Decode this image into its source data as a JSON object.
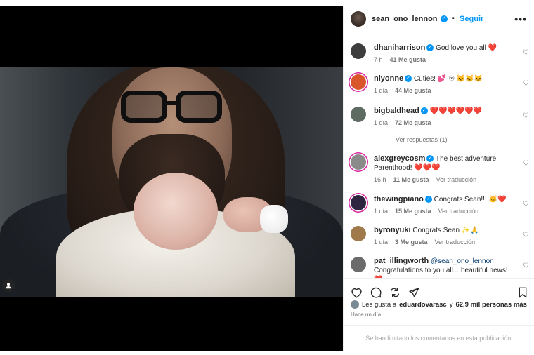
{
  "post": {
    "author": "sean_ono_lennon",
    "follow_label": "Seguir",
    "more_label": "•••",
    "separator": "•"
  },
  "comments": [
    {
      "user": "dhaniharrison",
      "verified": true,
      "text": "God love you all",
      "emoji": "❤️",
      "time": "7 h",
      "likes": "41 Me gusta",
      "extra": "···",
      "avatar_color": "#3d3d3d"
    },
    {
      "user": "nlyonne",
      "verified": true,
      "text": "Cuties!",
      "emoji": "💕 ♾ 🐱🐱🐱",
      "time": "1 día",
      "likes": "44 Me gusta",
      "avatar_color": "#d9552b"
    },
    {
      "user": "bigbaldhead",
      "verified": true,
      "text": "",
      "emoji": "❤️❤️❤️❤️❤️❤️",
      "time": "1 día",
      "likes": "72 Me gusta",
      "avatar_color": "#5e6b62"
    },
    {
      "user": "alexgreycosm",
      "verified": true,
      "text": "The best adventure! Parenthood!",
      "emoji": "❤️❤️❤️",
      "time": "16 h",
      "likes": "11 Me gusta",
      "translate": "Ver traducción",
      "avatar_color": "#8a8a8a"
    },
    {
      "user": "thewingpiano",
      "verified": true,
      "text": "Congrats Sean!!!",
      "emoji": "🐱❤️",
      "time": "1 día",
      "likes": "15 Me gusta",
      "translate": "Ver traducción",
      "avatar_color": "#2e2540"
    },
    {
      "user": "byronyuki",
      "verified": false,
      "text": "Congrats Sean",
      "emoji": "✨🙏",
      "time": "1 día",
      "likes": "3 Me gusta",
      "translate": "Ver traducción",
      "avatar_color": "#a07a4a"
    },
    {
      "user": "pat_illingworth",
      "verified": false,
      "mention": "@sean_ono_lennon",
      "text": "Congratulations to you all... beautiful news!",
      "emoji": "❤️",
      "avatar_color": "#6b6b6b"
    }
  ],
  "replies_label": "Ver respuestas (1)",
  "likes": {
    "prefix": "Les gusta a",
    "user": "eduardovarasc",
    "middle": "y",
    "count": "62,9 mil personas más"
  },
  "time_ago": "Hace un día",
  "comments_limited": "Se han limitado los comentarios en esta publicación.",
  "icons": [
    "heart-icon",
    "comment-icon",
    "share-icon",
    "send-icon",
    "bookmark-icon"
  ]
}
